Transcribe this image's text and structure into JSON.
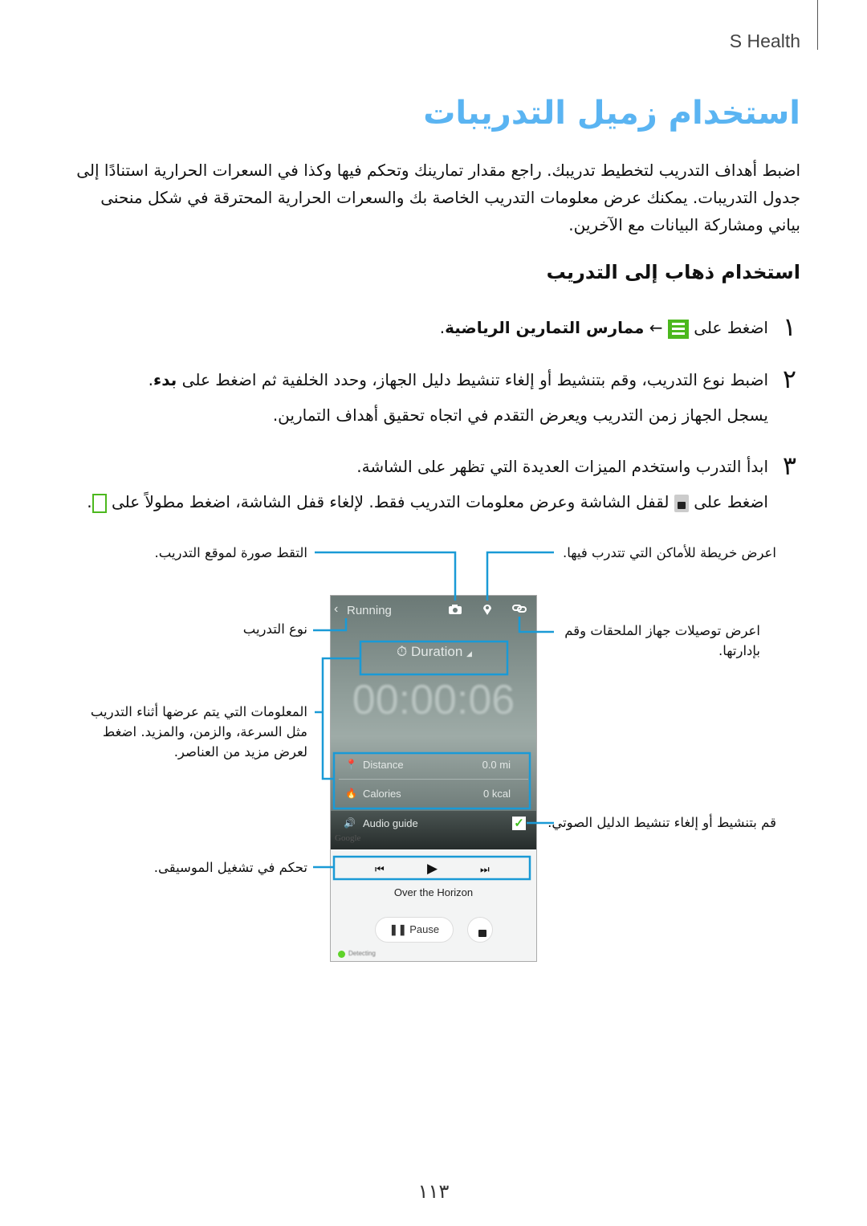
{
  "header": {
    "app": "S Health"
  },
  "title": "استخدام زميل التدريبات",
  "intro": "اضبط أهداف التدريب لتخطيط تدريبك. راجع مقدار تمارينك وتحكم فيها وكذا في السعرات الحرارية استنادًا إلى جدول التدريبات. يمكنك عرض معلومات التدريب الخاصة بك والسعرات الحرارية المحترقة في شكل منحنى بياني ومشاركة البيانات مع الآخرين.",
  "section_heading": "استخدام ذهاب إلى التدريب",
  "steps": [
    {
      "num": "١",
      "pre": "اضغط على",
      "arrow": "←",
      "bold": "ممارس التمارين الرياضية",
      "post": "."
    },
    {
      "num": "٢",
      "pre": "اضبط نوع التدريب، وقم بتنشيط أو إلغاء تنشيط دليل الجهاز، وحدد الخلفية ثم اضغط على",
      "bold": "بدء",
      "post": ".",
      "note": "يسجل الجهاز زمن التدريب ويعرض التقدم في اتجاه تحقيق أهداف التمارين."
    },
    {
      "num": "٣",
      "text": "ابدأ التدرب واستخدم الميزات العديدة التي تظهر على الشاشة.",
      "note_pre": "اضغط على",
      "note_mid": "لقفل الشاشة وعرض معلومات التدريب فقط. لإلغاء قفل الشاشة، اضغط مطولاً على",
      "note_post": "."
    }
  ],
  "callouts": {
    "photo": "التقط صورة لموقع التدريب.",
    "map": "اعرض خريطة للأماكن التي تتدرب فيها.",
    "type": "نوع التدريب",
    "accessories": "اعرض توصيلات جهاز الملحقات وقم بإدارتها.",
    "info": "المعلومات التي يتم عرضها أثناء التدريب مثل السرعة، والزمن، والمزيد. اضغط لعرض مزيد من العناصر.",
    "audio": "قم بتنشيط أو إلغاء تنشيط الدليل الصوتي.",
    "music": "تحكم في تشغيل الموسيقى."
  },
  "phone": {
    "workout": "Running",
    "mode": "Duration",
    "timer": "00:00:06",
    "rows": [
      {
        "label": "Distance",
        "value": "0.0 mi"
      },
      {
        "label": "Calories",
        "value": "0 kcal"
      }
    ],
    "audio_label": "Audio guide",
    "audio_checked": true,
    "google": "Google",
    "track": "Over the Horizon",
    "pause": "Pause",
    "status": "Detecting"
  },
  "colors": {
    "title": "#5ab4f2",
    "callout_line": "#1a9ad6",
    "icon_green": "#4cb81e"
  },
  "page_number": "١١٣"
}
